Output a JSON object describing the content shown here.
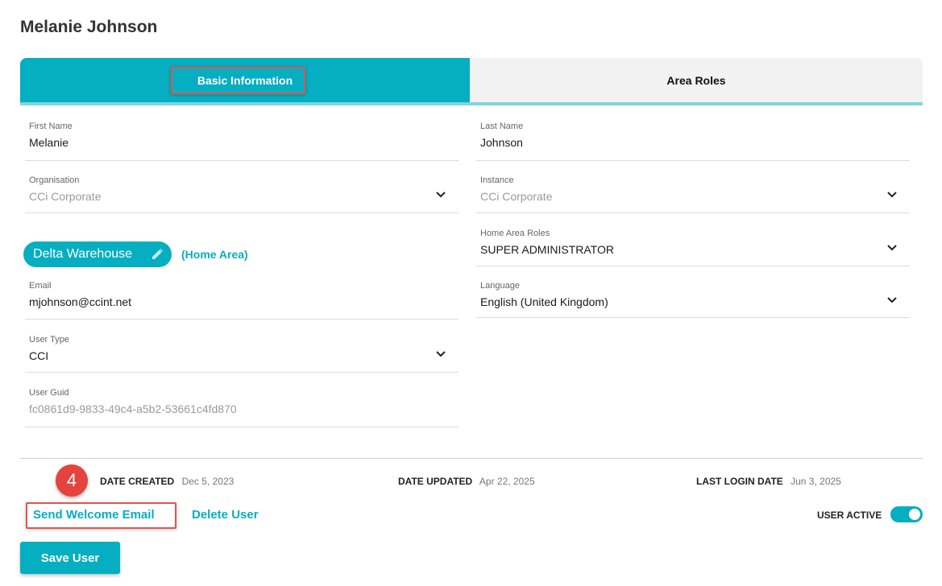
{
  "page": {
    "title": "Melanie Johnson"
  },
  "tabs": [
    {
      "label": "Basic Information",
      "active": true
    },
    {
      "label": "Area Roles",
      "active": false
    }
  ],
  "fields": {
    "first_name": {
      "label": "First Name",
      "value": "Melanie"
    },
    "last_name": {
      "label": "Last Name",
      "value": "Johnson"
    },
    "organisation": {
      "label": "Organisation",
      "value": "CCi Corporate"
    },
    "instance": {
      "label": "Instance",
      "value": "CCi Corporate"
    },
    "home_area_roles": {
      "label": "Home Area Roles",
      "value": "SUPER ADMINISTRATOR"
    },
    "email": {
      "label": "Email",
      "value": "mjohnson@ccint.net"
    },
    "language": {
      "label": "Language",
      "value": "English (United Kingdom)"
    },
    "user_type": {
      "label": "User Type",
      "value": "CCI"
    },
    "user_guid": {
      "label": "User Guid",
      "value": "fc0861d9-9833-49c4-a5b2-53661c4fd870"
    }
  },
  "area_chip": {
    "label": "Delta Warehouse",
    "icon": "pencil-icon",
    "home_area_label": "(Home Area)"
  },
  "meta": {
    "date_created": {
      "label": "DATE CREATED",
      "value": "Dec 5, 2023"
    },
    "date_updated": {
      "label": "DATE UPDATED",
      "value": "Apr 22, 2025"
    },
    "last_login": {
      "label": "LAST LOGIN DATE",
      "value": "Jun 3, 2025"
    }
  },
  "step_badge": "4",
  "actions": {
    "send_welcome_email": "Send Welcome Email",
    "delete_user": "Delete User",
    "user_active_label": "USER ACTIVE",
    "user_active": true,
    "save_user": "Save User"
  },
  "colors": {
    "accent": "#05aec0",
    "accent_light": "#7fd6df",
    "highlight": "#e0564f",
    "badge": "#e4433e"
  }
}
